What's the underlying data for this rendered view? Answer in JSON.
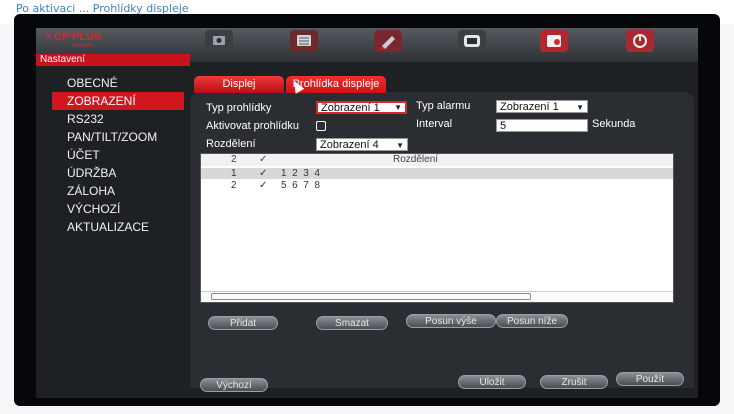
{
  "caption": "Po aktivaci ... Prohlídky displeje",
  "brand": {
    "name": "CP PLUS",
    "sub": "Uvision"
  },
  "toolbar": {
    "icons": [
      "camera-icon",
      "network-icon",
      "settings-pencil-icon",
      "display-icon",
      "record-icon",
      "power-icon"
    ],
    "colors": [
      "#3a3f44",
      "#6b2a2a",
      "#7a2730",
      "#3a3f44",
      "#b3282f",
      "#a82a30"
    ]
  },
  "window": {
    "title": "Nastavení"
  },
  "sidebar": {
    "items": [
      {
        "label": "OBECNÉ"
      },
      {
        "label": "ZOBRAZENÍ",
        "active": true
      },
      {
        "label": "RS232"
      },
      {
        "label": "PAN/TILT/ZOOM"
      },
      {
        "label": "ÚČET"
      },
      {
        "label": "ÚDRŽBA"
      },
      {
        "label": "ZÁLOHA"
      },
      {
        "label": "VÝCHOZÍ"
      },
      {
        "label": "AKTUALIZACE"
      }
    ]
  },
  "tabs": [
    {
      "label": "Displej"
    },
    {
      "label": "Prohlídka displeje",
      "active": true
    }
  ],
  "form": {
    "tour_type_label": "Typ prohlídky",
    "tour_type_value": "Zobrazení 1",
    "alarm_type_label": "Typ alarmu",
    "alarm_type_value": "Zobrazení 1",
    "enable_tour_label": "Aktivovat prohlídku",
    "interval_label": "Interval",
    "interval_value": "5",
    "interval_unit": "Sekunda",
    "split_label": "Rozdělení",
    "split_value": "Zobrazení 4"
  },
  "table": {
    "header": {
      "count": "2",
      "check": "✓",
      "title": "Rozdělení"
    },
    "rows": [
      {
        "index": "1",
        "check": "✓",
        "channels": "1  2  3  4"
      },
      {
        "index": "2",
        "check": "✓",
        "channels": "5  6  7  8"
      }
    ]
  },
  "actions": {
    "add": "Přidat",
    "delete": "Smazat",
    "move_up": "Posun výše",
    "move_down": "Posun níže"
  },
  "footer": {
    "default": "Výchozí",
    "save": "Uložit",
    "cancel": "Zrušit",
    "apply": "Použít"
  }
}
